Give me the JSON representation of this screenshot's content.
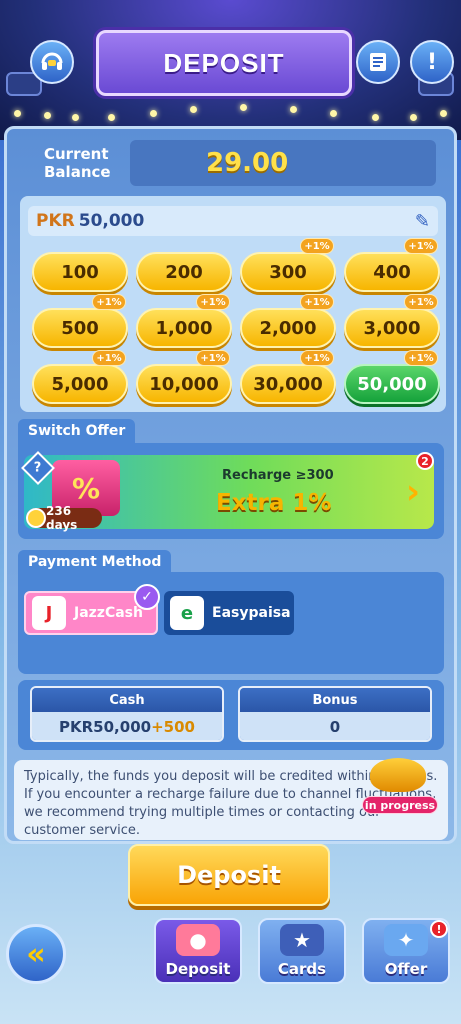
{
  "header": {
    "title": "DEPOSIT",
    "support_icon": "headset-chat-icon",
    "records_icon": "record-list-icon",
    "info_icon": "!"
  },
  "balance": {
    "label_line1": "Current",
    "label_line2": "Balance",
    "value": "29.00"
  },
  "amount": {
    "currency": "PKR",
    "value": "50,000"
  },
  "chips": [
    {
      "label": "100",
      "bonus": ""
    },
    {
      "label": "200",
      "bonus": ""
    },
    {
      "label": "300",
      "bonus": "+1%"
    },
    {
      "label": "400",
      "bonus": "+1%"
    },
    {
      "label": "500",
      "bonus": "+1%"
    },
    {
      "label": "1,000",
      "bonus": "+1%"
    },
    {
      "label": "2,000",
      "bonus": "+1%"
    },
    {
      "label": "3,000",
      "bonus": "+1%"
    },
    {
      "label": "5,000",
      "bonus": "+1%"
    },
    {
      "label": "10,000",
      "bonus": "+1%"
    },
    {
      "label": "30,000",
      "bonus": "+1%"
    },
    {
      "label": "50,000",
      "bonus": "+1%",
      "selected": true
    }
  ],
  "offer": {
    "section_label": "Switch Offer",
    "help": "?",
    "gift_symbol": "%",
    "days": "236 days",
    "subtitle": "Recharge ≥300",
    "title": "Extra  1%",
    "badge": "2",
    "chevron": "›"
  },
  "payment": {
    "section_label": "Payment Method",
    "methods": [
      {
        "name": "JazzCash",
        "logo": "J",
        "selected": true
      },
      {
        "name": "Easypaisa",
        "logo": "e",
        "selected": false
      }
    ],
    "check": "✓"
  },
  "summary": {
    "cash_label": "Cash",
    "cash_value": "PKR50,000",
    "cash_plus": "+500",
    "bonus_label": "Bonus",
    "bonus_value": "0"
  },
  "note": "Typically, the funds you deposit will be credited within minutes. If you encounter a recharge failure due to channel fluctuations, we recommend trying multiple times or contacting our customer service.",
  "lamp": {
    "label": "in progress"
  },
  "deposit_button": "Deposit",
  "back_button": "«",
  "tabs": [
    {
      "label": "Deposit",
      "icon": "chips-icon",
      "active": true
    },
    {
      "label": "Cards",
      "icon": "cards-icon",
      "active": false
    },
    {
      "label": "Offer",
      "icon": "party-popper-icon",
      "active": false,
      "badge": "!"
    }
  ],
  "colors": {
    "gold": "#f7b500",
    "selected_green": "#15a23b",
    "panel_blue": "#4b86d6",
    "alert_red": "#e8222a"
  }
}
